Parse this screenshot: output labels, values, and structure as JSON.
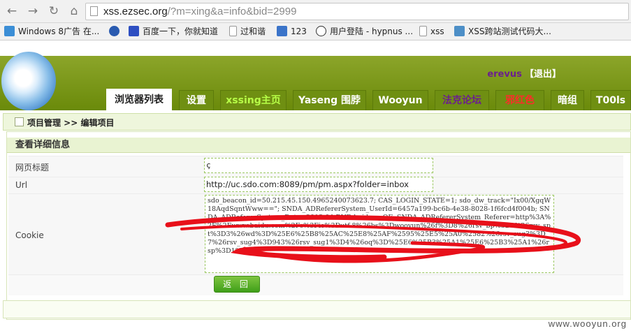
{
  "browser": {
    "url_host": "xss.ezsec.org",
    "url_rest": "/?m=xing&a=info&bid=2999",
    "bookmarks": [
      {
        "label": "Windows 8广告 在...",
        "icon": "windows-icon",
        "color": "#3b8ed6"
      },
      {
        "label": "",
        "icon": "globe-icon",
        "color": "#2a5bb0"
      },
      {
        "label": "百度一下，你就知道",
        "icon": "baidu-paw-icon",
        "color": "#2e4fc2"
      },
      {
        "label": "过和谐",
        "icon": "page-icon",
        "color": "#cccccc"
      },
      {
        "label": "123",
        "icon": "123-icon",
        "color": "#3b74c9"
      },
      {
        "label": "用户登陆 - hypnus ...",
        "icon": "swirl-icon",
        "color": "#333333"
      },
      {
        "label": "xss",
        "icon": "page-icon",
        "color": "#cccccc"
      },
      {
        "label": "XSS跨站测试代码大...",
        "icon": "image-icon",
        "color": "#4d8fc7"
      }
    ]
  },
  "header": {
    "username": "erevus",
    "logout": "【退出】",
    "tabs": [
      {
        "label": "浏览器列表",
        "active": true,
        "color": "#222222"
      },
      {
        "label": "设置",
        "active": false,
        "color": "#ffffff"
      },
      {
        "label": "xssing主页",
        "active": false,
        "color": "#b7ff47"
      },
      {
        "label": "Yaseng 围脖",
        "active": false,
        "color": "#ffffff"
      },
      {
        "label": "Wooyun",
        "active": false,
        "color": "#ffffff"
      },
      {
        "label": "法克论坛",
        "active": false,
        "color": "#6b1f8e"
      },
      {
        "label": "邪红色",
        "active": false,
        "color": "#ff2b2b"
      },
      {
        "label": "暗组",
        "active": false,
        "color": "#ffffff"
      },
      {
        "label": "T00ls",
        "active": false,
        "color": "#ffffff"
      }
    ]
  },
  "breadcrumb": "项目管理 >> 编辑项目",
  "panel": {
    "title": "查看详细信息",
    "rows": [
      {
        "label": "网页标题",
        "value": "ç"
      },
      {
        "label": "Url",
        "value": "http://uc.sdo.com:8089/pm/pm.aspx?folder=inbox"
      },
      {
        "label": "Cookie",
        "value": "sdo_beacon_id=50.215.45.150.4965240073623.7; CAS_LOGIN_STATE=1; sdo_dw_track=\"Ix00/XgqW18AqdSqntWww==\"; SNDA_ADRefererSystem_UserId=6457a199-bc6b-4e38-8028-1f6fcd4f004b; SNDA_ADRefererSystem_Date=2013-04-BNB-baiduzq-OF; SNDA_ADRefererSystem_Referer=http%3A%2F%2Fwww.baidu.com%2Fs%3Fie%3Dutf-8%26bs%3Dwooyun%26f%3D8%26rsv_bp%3D1%26rsv_spt%3D3%26wd%3D%25E6%25B8%25AC%25E8%25AF%2595%25E5%25A0%2582%26rsv_sug3%3D7%26rsv_sug4%3D943%26rsv_sug1%3D4%26oq%3D%25E6%25B3%25A1%25E6%25B3%25A1%26rsp%3D1%26r"
      }
    ],
    "back_button": "返 回"
  },
  "watermark": "www.wooyun.org"
}
